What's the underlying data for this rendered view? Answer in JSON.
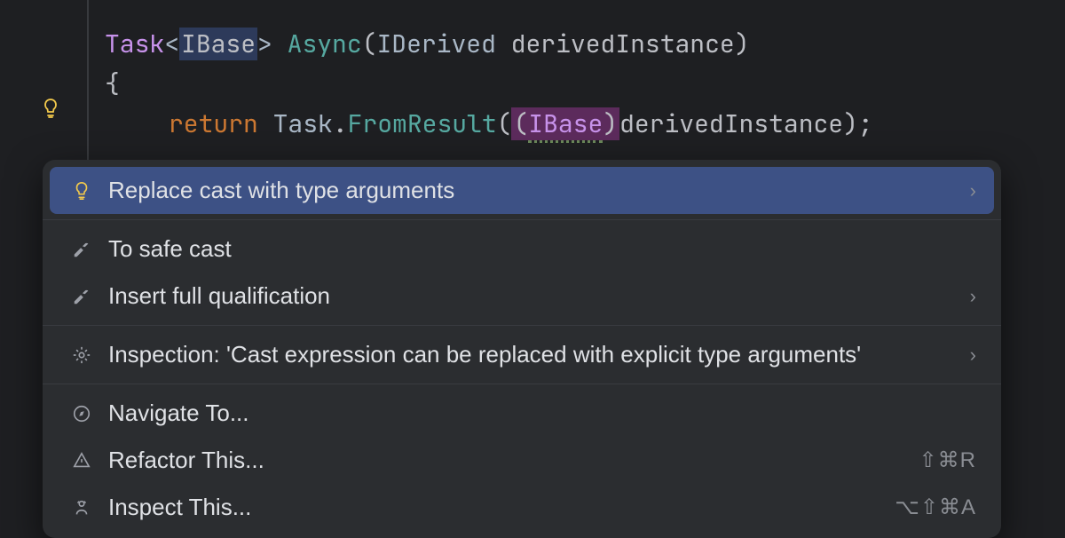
{
  "code": {
    "task": "Task",
    "ibase": "IBase",
    "method": "Async",
    "paramType": "IDerived",
    "paramName": "derivedInstance",
    "openBrace": "{",
    "return": "return",
    "taskClass": "Task",
    "fromResult": "FromResult",
    "castType": "IBase",
    "castArg": "derivedInstance"
  },
  "menu": {
    "items": [
      {
        "label": "Replace cast with type arguments",
        "icon": "bulb",
        "chevron": true,
        "selected": true
      },
      {
        "label": "To safe cast",
        "icon": "hammer",
        "chevron": false
      },
      {
        "label": "Insert full qualification",
        "icon": "hammer",
        "chevron": true
      },
      {
        "label": "Inspection: 'Cast expression can be replaced with explicit type arguments'",
        "icon": "gear",
        "chevron": true
      },
      {
        "label": "Navigate To...",
        "icon": "compass",
        "chevron": false
      },
      {
        "label": "Refactor This...",
        "icon": "refactor",
        "shortcut": "⇧⌘R"
      },
      {
        "label": "Inspect This...",
        "icon": "inspect",
        "shortcut": "⌥⇧⌘A"
      }
    ]
  }
}
